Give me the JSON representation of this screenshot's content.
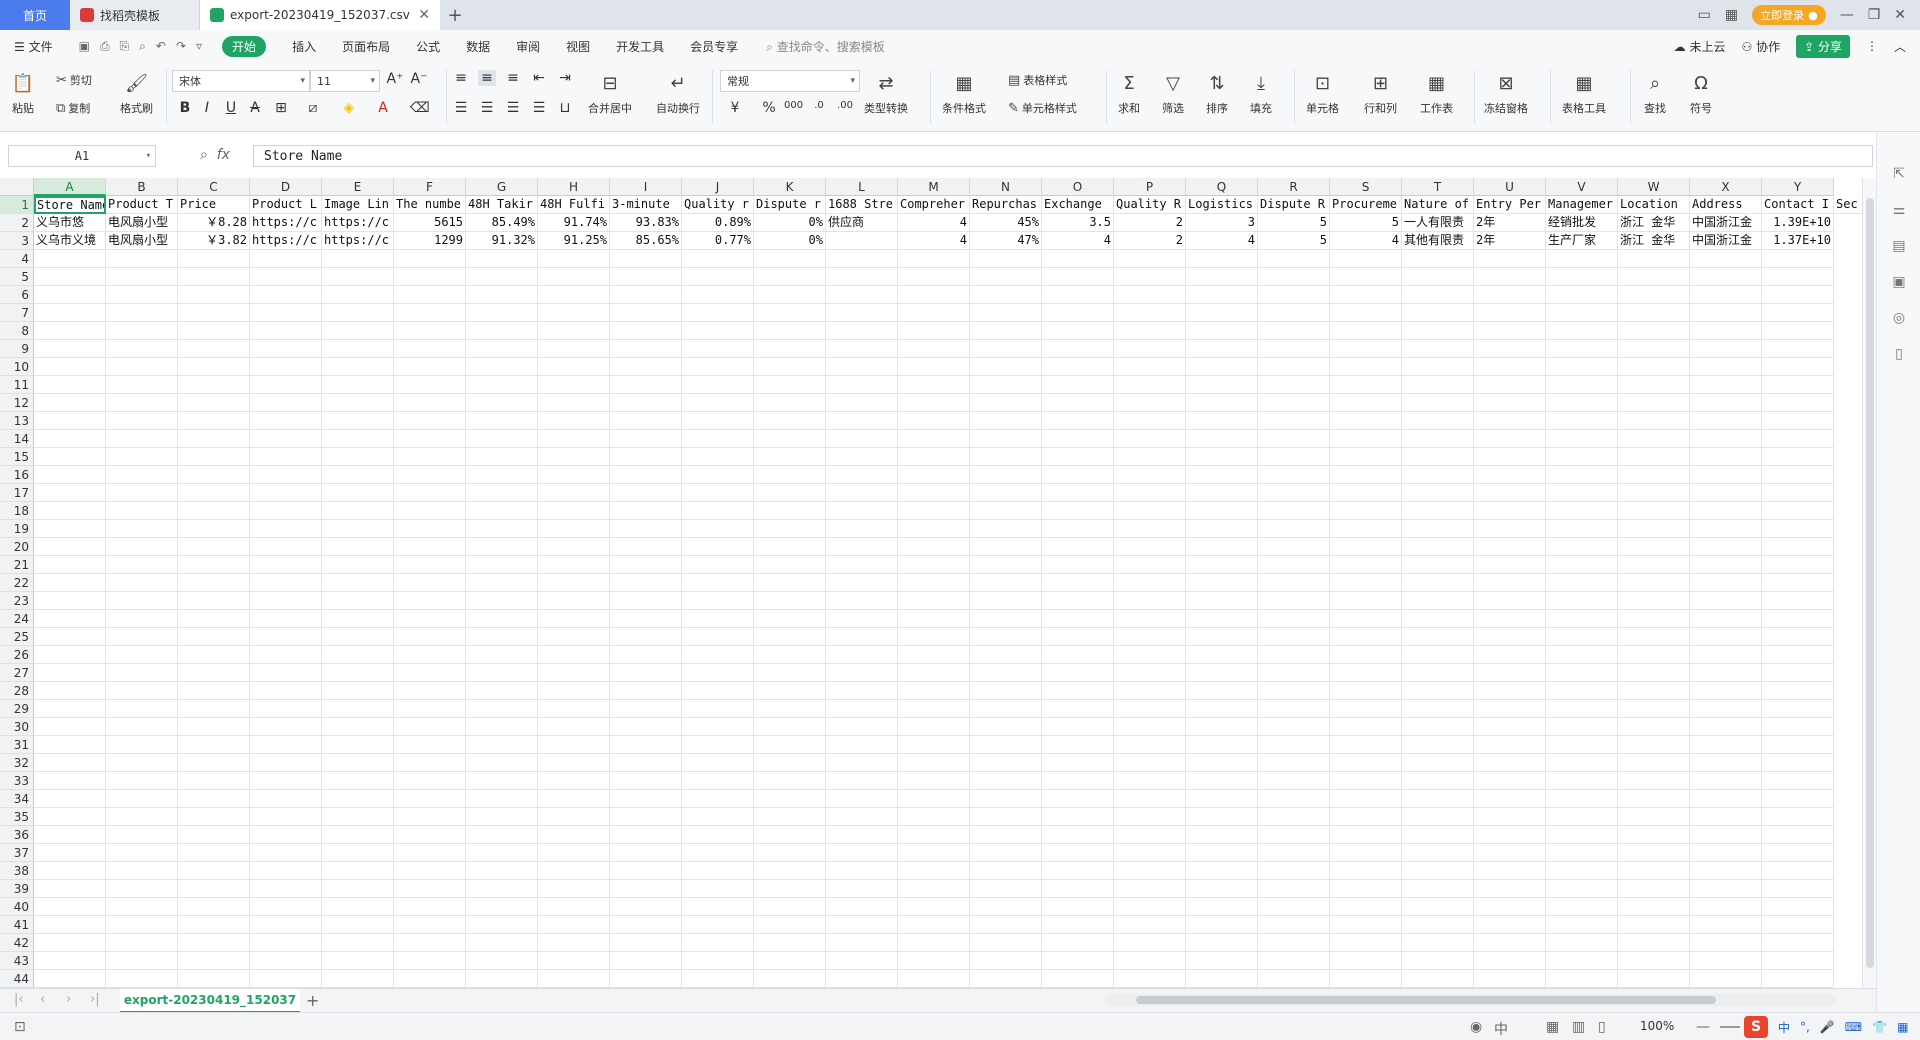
{
  "tabs": {
    "home": "首页",
    "template": "找稻壳模板",
    "file": "export-20230419_152037.csv"
  },
  "window": {
    "login": "立即登录"
  },
  "menu": {
    "file": "文件",
    "items": [
      "开始",
      "插入",
      "页面布局",
      "公式",
      "数据",
      "审阅",
      "视图",
      "开发工具",
      "会员专享"
    ],
    "search_placeholder": "查找命令、搜索模板",
    "cloud": "未上云",
    "collab": "协作",
    "share": "分享"
  },
  "ribbon": {
    "paste": "粘贴",
    "cut": "剪切",
    "copy": "复制",
    "format_painter": "格式刷",
    "font_name": "宋体",
    "font_size": "11",
    "merge": "合并居中",
    "wrap": "自动换行",
    "number_format": "常规",
    "type_convert": "类型转换",
    "cond_format": "条件格式",
    "table_style": "表格样式",
    "cell_style": "单元格样式",
    "sum": "求和",
    "filter": "筛选",
    "sort": "排序",
    "fill": "填充",
    "cell": "单元格",
    "rowcol": "行和列",
    "sheet": "工作表",
    "freeze": "冻结窗格",
    "table_tools": "表格工具",
    "find": "查找",
    "symbol": "符号"
  },
  "formula_bar": {
    "name_box": "A1",
    "content": "Store Name"
  },
  "grid": {
    "columns": [
      "A",
      "B",
      "C",
      "D",
      "E",
      "F",
      "G",
      "H",
      "I",
      "J",
      "K",
      "L",
      "M",
      "N",
      "O",
      "P",
      "Q",
      "R",
      "S",
      "T",
      "U",
      "V",
      "W",
      "X",
      "Y"
    ],
    "rows": [
      [
        "Store Name",
        "Product T",
        "Price",
        "Product L",
        "Image Lin",
        "The numbe",
        "48H Takir",
        "48H Fulfi",
        "3-minute",
        "Quality r",
        "Dispute r",
        "1688 Stre",
        "Compreher",
        "Repurchas",
        "Exchange",
        "Quality R",
        "Logistics",
        "Dispute R",
        "Procureme",
        "Nature of",
        "Entry Per",
        "Managemer",
        "Location",
        "Address",
        "Contact I"
      ],
      [
        "义乌市悠",
        "电风扇小型",
        "￥8.28",
        "https://c",
        "https://c",
        "5615",
        "85.49%",
        "91.74%",
        "93.83%",
        "0.89%",
        "0%",
        "供应商",
        "4",
        "45%",
        "3.5",
        "2",
        "3",
        "5",
        "5",
        "一人有限责",
        "2年",
        "经销批发",
        "浙江 金华",
        "中国浙江金",
        "1.39E+10"
      ],
      [
        "义乌市义境",
        "电风扇小型",
        "￥3.82",
        "https://c",
        "https://c",
        "1299",
        "91.32%",
        "91.25%",
        "85.65%",
        "0.77%",
        "0%",
        "",
        "4",
        "47%",
        "4",
        "2",
        "4",
        "5",
        "4",
        "其他有限责",
        "2年",
        "生产厂家",
        "浙江 金华",
        "中国浙江金",
        "1.37E+10"
      ]
    ],
    "overflow_header": "Sec",
    "row_count": 44
  },
  "sheet": {
    "name": "export-20230419_152037"
  },
  "status": {
    "zoom": "100%",
    "ime": [
      "中",
      "°,",
      "🎤",
      "⌨",
      "👕",
      "▦"
    ]
  }
}
